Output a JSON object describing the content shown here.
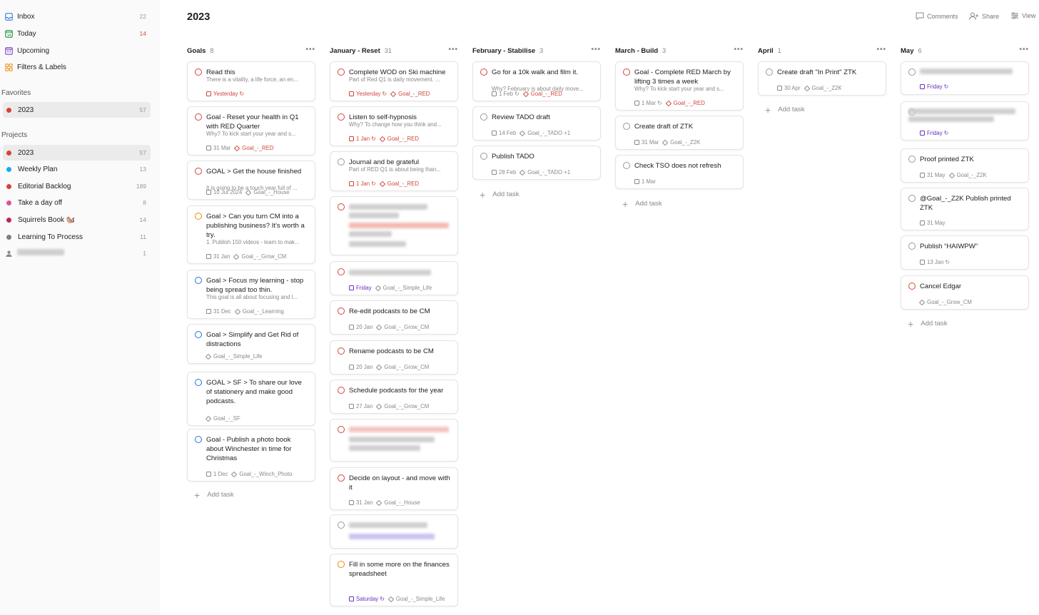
{
  "sidebar": {
    "nav": [
      {
        "label": "Inbox",
        "count": "22",
        "icon": "inbox-icon",
        "color": "#246fe0"
      },
      {
        "label": "Today",
        "count": "14",
        "icon": "calendar-today-icon",
        "color": "#058527"
      },
      {
        "label": "Upcoming",
        "count": "",
        "icon": "calendar-upcoming-icon",
        "color": "#692fc2"
      },
      {
        "label": "Filters & Labels",
        "count": "",
        "icon": "filters-labels-icon",
        "color": "#eb8909"
      }
    ],
    "favorites_heading": "Favorites",
    "favorites": [
      {
        "label": "2023",
        "count": "57",
        "color": "#db4035"
      }
    ],
    "projects_heading": "Projects",
    "projects": [
      {
        "label": "2023",
        "count": "57",
        "color": "#db4035"
      },
      {
        "label": "Weekly Plan",
        "count": "13",
        "color": "#14aaf5"
      },
      {
        "label": "Editorial Backlog",
        "count": "189",
        "color": "#db4035"
      },
      {
        "label": "Take a day off",
        "count": "8",
        "color": "#e05194"
      },
      {
        "label": "Squirrels Book 🐿️",
        "count": "14",
        "color": "#b8255f"
      },
      {
        "label": "Learning To Process",
        "count": "11",
        "color": "#808080"
      },
      {
        "label": "",
        "count": "1",
        "color": "#808080"
      }
    ]
  },
  "header": {
    "title": "2023",
    "comments": "Comments",
    "share": "Share",
    "view": "View"
  },
  "add_task_label": "Add task",
  "columns": [
    {
      "title": "Goals",
      "count": "8",
      "tasks": [
        {
          "title": "Read this",
          "desc": "There is a vitality, a life force, an en...",
          "date": "Yesterday",
          "date_color": "red",
          "recurring": true,
          "label": "",
          "priority": "p1"
        },
        {
          "title": "Goal - Reset your health in Q1 with RED Quarter",
          "desc": "Why? To kick start your year and s...",
          "date": "31 Mar",
          "date_color": "",
          "label": "Goal_-_RED",
          "label_color": "red",
          "priority": "p1"
        },
        {
          "title": "GOAL > Get the house finished",
          "desc": "It is going to be a touch year full of ...",
          "date": "10 Jul 2024",
          "date_color": "",
          "label": "Goal_-_House",
          "priority": "p1"
        },
        {
          "title": "Goal > Can you turn CM into a publishing business? It's worth a try.",
          "desc": "1. Publish 150 videos - learn to mak...",
          "date": "31 Jan",
          "date_color": "",
          "label": "Goal_-_Grow_CM",
          "priority": "p2"
        },
        {
          "title": "Goal > Focus my learning - stop being spread too thin.",
          "desc": "This goal is all about focusing and l...",
          "date": "31 Dec",
          "date_color": "",
          "label": "Goal_-_Learning",
          "priority": "p3"
        },
        {
          "title": "Goal > Simplify and Get Rid of distractions",
          "desc": "",
          "date": "",
          "label": "Goal_-_Simple_Life",
          "priority": "p3"
        },
        {
          "title": "GOAL > SF > To share our love of stationery and make good podcasts.",
          "desc": "",
          "date": "",
          "label": "Goal_-_SF",
          "priority": "p3"
        },
        {
          "title": "Goal - Publish a photo book about Winchester in time for Christmas",
          "desc": "",
          "date": "1 Dec",
          "date_color": "",
          "label": "Goal_-_Winch_Photo",
          "priority": "p3"
        }
      ]
    },
    {
      "title": "January - Reset",
      "count": "31",
      "tasks": [
        {
          "title": "Complete WOD on Ski machine",
          "desc": "Part of Red Q1 is daily movement. ...",
          "date": "Yesterday",
          "date_color": "red",
          "recurring": true,
          "label": "Goal_-_RED",
          "label_color": "red",
          "priority": "p1"
        },
        {
          "title": "Listen to self-hypnosis",
          "desc": "Why? To change how you think and...",
          "date": "1 Jan",
          "date_color": "red",
          "recurring": true,
          "label": "Goal_-_RED",
          "label_color": "red",
          "priority": "p1"
        },
        {
          "title": "Journal and be grateful",
          "desc": "Part of RED Q1 is about being than...",
          "date": "1 Jan",
          "date_color": "red",
          "recurring": true,
          "label": "Goal_-_RED",
          "label_color": "red",
          "priority": "p4"
        },
        {
          "title": "",
          "desc": "",
          "date": "",
          "label": "",
          "priority": "p1",
          "blurred": true
        },
        {
          "title": "",
          "desc": "",
          "date": "Friday",
          "date_color": "purple",
          "label": "Goal_-_Simple_Life",
          "priority": "p1",
          "blurred": true
        },
        {
          "title": "Re-edit podcasts to be CM",
          "desc": "",
          "date": "20 Jan",
          "date_color": "",
          "label": "Goal_-_Grow_CM",
          "priority": "p1"
        },
        {
          "title": "Rename podcasts to be CM",
          "desc": "",
          "date": "20 Jan",
          "date_color": "",
          "label": "Goal_-_Grow_CM",
          "priority": "p1"
        },
        {
          "title": "Schedule podcasts for the year",
          "desc": "",
          "date": "27 Jan",
          "date_color": "",
          "label": "Goal_-_Grow_CM",
          "priority": "p1"
        },
        {
          "title": "",
          "desc": "",
          "date": "",
          "label": "",
          "priority": "p1",
          "blurred": true
        },
        {
          "title": "Decide on layout - and move with it",
          "desc": "",
          "date": "31 Jan",
          "date_color": "",
          "label": "Goal_-_House",
          "priority": "p1"
        },
        {
          "title": "",
          "desc": "",
          "date": "",
          "label": "",
          "priority": "p4",
          "blurred": true
        },
        {
          "title": "Fill in some more on the finances spreadsheet",
          "desc": "",
          "date": "Saturday",
          "date_color": "purple",
          "recurring": true,
          "label": "Goal_-_Simple_Life",
          "priority": "p2"
        }
      ]
    },
    {
      "title": "February - Stabilise",
      "count": "3",
      "tasks": [
        {
          "title": "Go for a 10k walk and film it.",
          "desc": "Why? February is about daily move...",
          "date": "1 Feb",
          "date_color": "",
          "recurring": true,
          "label": "Goal_-_RED",
          "label_color": "red",
          "priority": "p1"
        },
        {
          "title": "Review TADO draft",
          "desc": "",
          "date": "14 Feb",
          "date_color": "",
          "label": "Goal_-_TADO +1",
          "priority": "p4"
        },
        {
          "title": "Publish TADO",
          "desc": "",
          "date": "28 Feb",
          "date_color": "",
          "label": "Goal_-_TADO +1",
          "priority": "p4"
        }
      ]
    },
    {
      "title": "March - Build",
      "count": "3",
      "tasks": [
        {
          "title": "Goal - Complete RED March by lifting 3 times a week",
          "desc": "Why? To kick start your year and s...",
          "date": "1 Mar",
          "date_color": "",
          "recurring": true,
          "label": "Goal_-_RED",
          "label_color": "red",
          "priority": "p1"
        },
        {
          "title": "Create draft of ZTK",
          "desc": "",
          "date": "31 Mar",
          "date_color": "",
          "label": "Goal_-_Z2K",
          "priority": "p4"
        },
        {
          "title": "Check TSO does not refresh",
          "desc": "",
          "date": "1 Mar",
          "date_color": "",
          "label": "",
          "priority": "p4"
        }
      ]
    },
    {
      "title": "April",
      "count": "1",
      "tasks": [
        {
          "title": "Create draft \"In Print\" ZTK",
          "desc": "",
          "date": "30 Apr",
          "date_color": "",
          "label": "Goal_-_Z2K",
          "priority": "p4"
        }
      ]
    },
    {
      "title": "May",
      "count": "6",
      "tasks": [
        {
          "title": "",
          "desc": "",
          "date": "Friday",
          "date_color": "purple",
          "recurring": true,
          "label": "",
          "priority": "p4",
          "blurred": true
        },
        {
          "title": "",
          "desc": "",
          "date": "Friday",
          "date_color": "purple",
          "recurring": true,
          "label": "",
          "priority": "p4",
          "blurred": true
        },
        {
          "title": "Proof printed ZTK",
          "desc": "",
          "date": "31 May",
          "date_color": "",
          "label": "Goal_-_Z2K",
          "priority": "p4"
        },
        {
          "title": "@Goal_-_Z2K Publish printed ZTK",
          "desc": "",
          "date": "31 May",
          "date_color": "",
          "label": "",
          "priority": "p4"
        },
        {
          "title": "Publish “HAIWPW”",
          "desc": "",
          "date": "13 Jan",
          "date_color": "",
          "recurring": true,
          "label": "",
          "priority": "p4"
        },
        {
          "title": "Cancel Edgar",
          "desc": "",
          "date": "",
          "label": "Goal_-_Grow_CM",
          "priority": "p1"
        }
      ]
    }
  ]
}
